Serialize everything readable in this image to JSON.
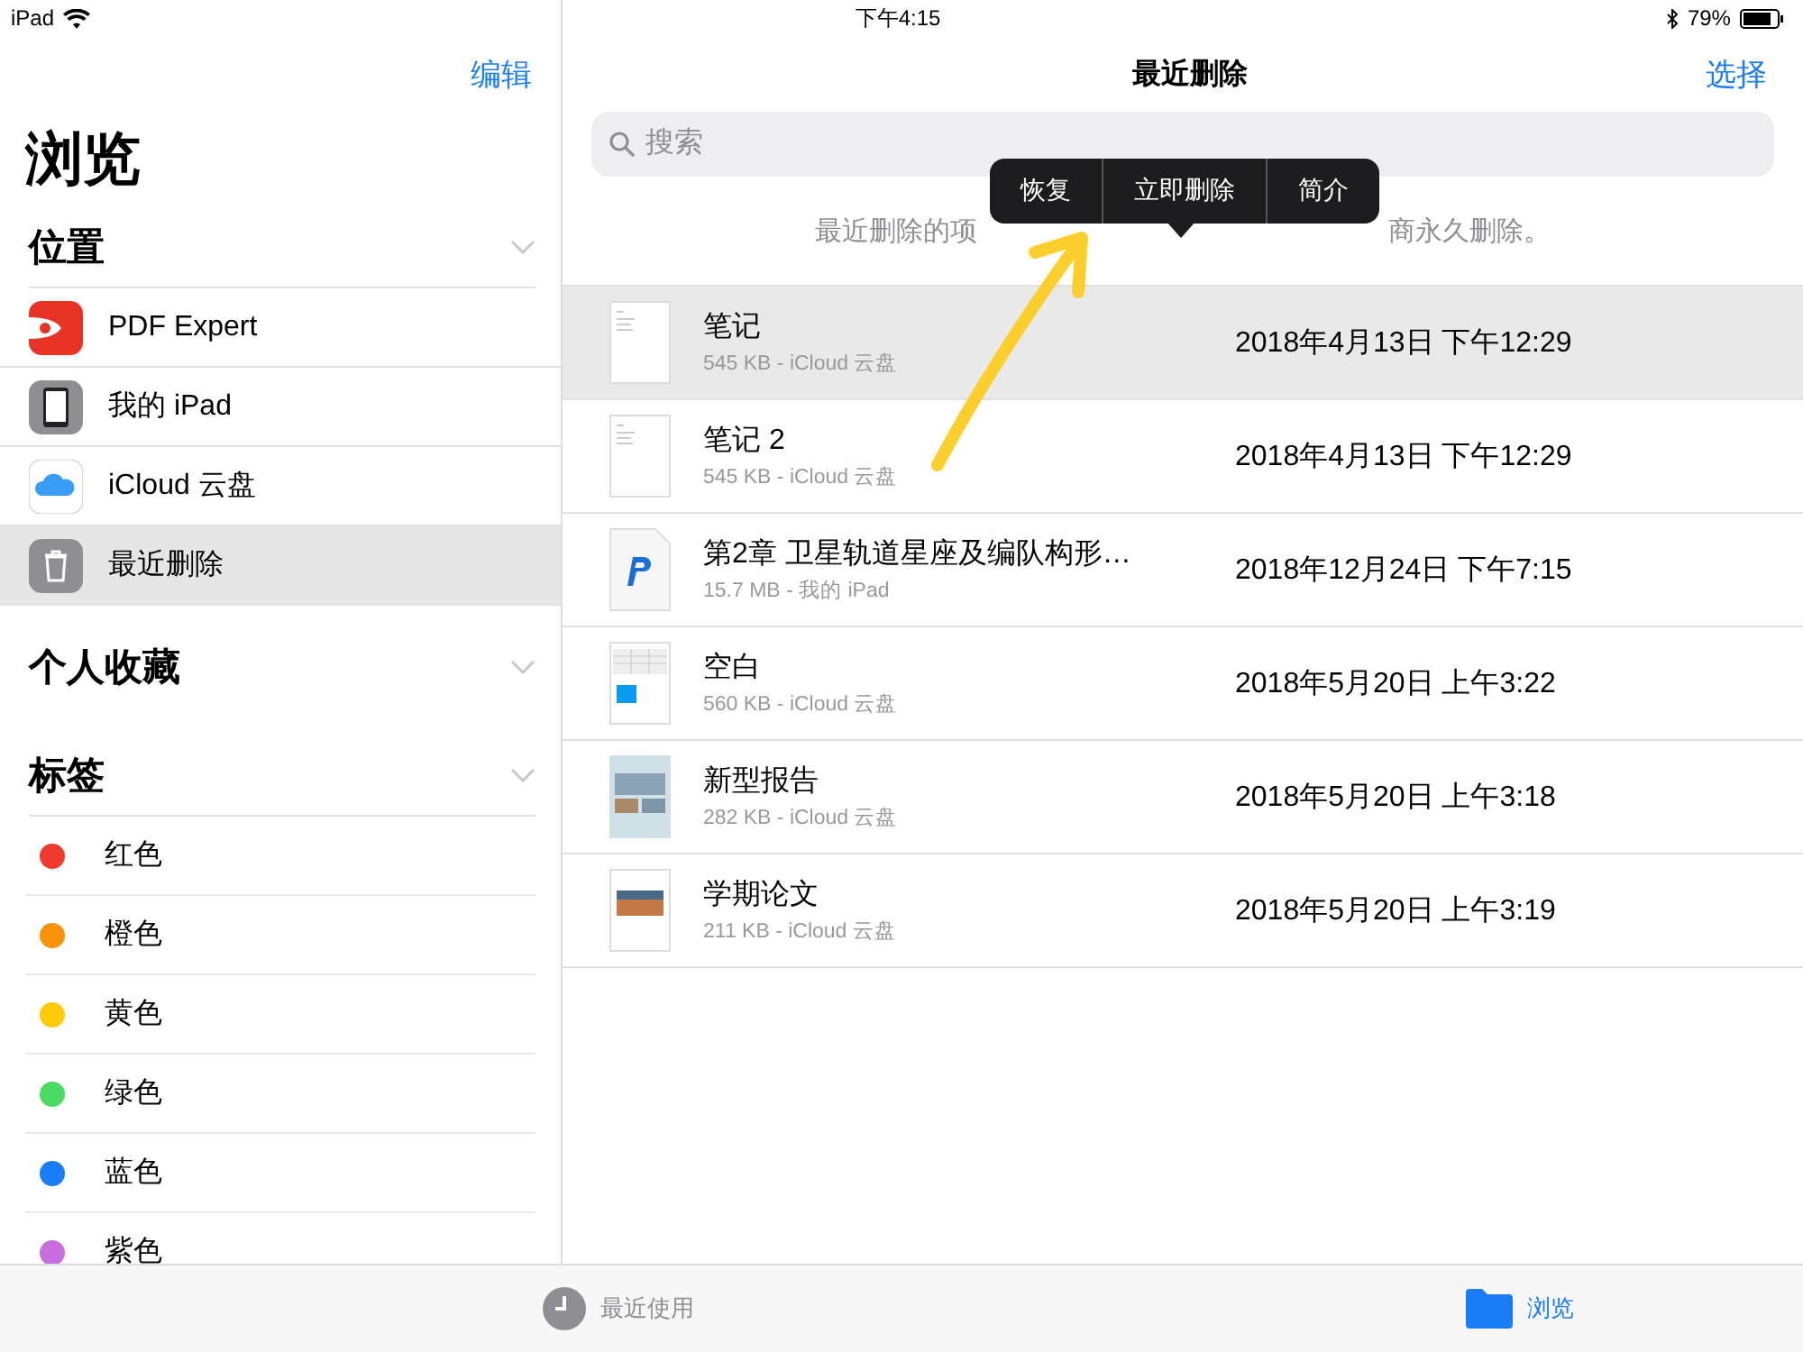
{
  "status_bar": {
    "device": "iPad",
    "time": "下午4:15",
    "battery": "79%"
  },
  "sidebar": {
    "edit": "编辑",
    "title": "浏览",
    "sections": [
      {
        "title": "位置",
        "items": [
          {
            "kind": "pdf",
            "label": "PDF Expert",
            "selected": false
          },
          {
            "kind": "device",
            "label": "我的 iPad",
            "selected": false
          },
          {
            "kind": "cloud",
            "label": "iCloud 云盘",
            "selected": false
          },
          {
            "kind": "trash",
            "label": "最近删除",
            "selected": true
          }
        ]
      },
      {
        "title": "个人收藏"
      },
      {
        "title": "标签",
        "tags": [
          {
            "label": "红色",
            "color": "#f03a30"
          },
          {
            "label": "橙色",
            "color": "#f7920b"
          },
          {
            "label": "黄色",
            "color": "#fdcb0a"
          },
          {
            "label": "绿色",
            "color": "#4cd964"
          },
          {
            "label": "蓝色",
            "color": "#1a7cf7"
          },
          {
            "label": "紫色",
            "color": "#c86dde"
          }
        ]
      }
    ]
  },
  "main": {
    "title": "最近删除",
    "select": "选择",
    "search": {
      "placeholder": "搜索"
    },
    "info_left": "最近删除的项",
    "info_right": "商永久删除。",
    "menu": [
      "恢复",
      "立即删除",
      "简介"
    ],
    "files": [
      {
        "kind": "text",
        "name": "笔记",
        "meta": "545 KB - iCloud 云盘",
        "date": "2018年4月13日 下午12:29",
        "selected": true
      },
      {
        "kind": "text",
        "name": "笔记 2",
        "meta": "545 KB - iCloud 云盘",
        "date": "2018年4月13日 下午12:29",
        "selected": false
      },
      {
        "kind": "pages",
        "name": "第2章 卫星轨道星座及编队构形…",
        "meta": "15.7 MB - 我的 iPad",
        "date": "2018年12月24日 下午7:15",
        "selected": false
      },
      {
        "kind": "sheet",
        "name": "空白",
        "meta": "560 KB - iCloud 云盘",
        "date": "2018年5月20日 上午3:22",
        "selected": false
      },
      {
        "kind": "report",
        "name": "新型报告",
        "meta": "282 KB - iCloud 云盘",
        "date": "2018年5月20日 上午3:18",
        "selected": false
      },
      {
        "kind": "paper",
        "name": "学期论文",
        "meta": "211 KB - iCloud 云盘",
        "date": "2018年5月20日 上午3:19",
        "selected": false
      }
    ]
  },
  "tab_bar": [
    {
      "kind": "recent",
      "label": "最近使用",
      "selected": false
    },
    {
      "kind": "browse",
      "label": "浏览",
      "selected": true
    }
  ]
}
